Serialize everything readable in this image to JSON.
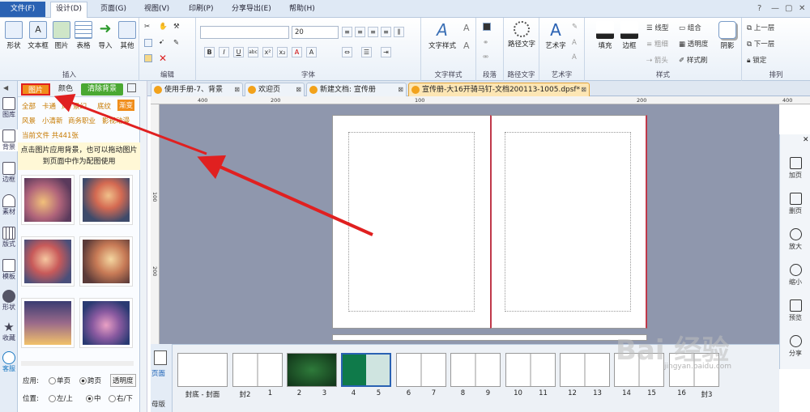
{
  "menu": {
    "file": "文件(F)",
    "items": [
      "设计(D)",
      "页面(G)",
      "视图(V)",
      "印刷(P)",
      "分享导出(E)",
      "帮助(H)"
    ],
    "active_index": 0,
    "window_controls": [
      "?",
      "—",
      "▢",
      "✕"
    ]
  },
  "ribbon": {
    "insert": {
      "label": "插入",
      "buttons": [
        "形状",
        "文本框",
        "图片",
        "表格",
        "导入",
        "其他"
      ]
    },
    "edit": {
      "label": "编辑"
    },
    "font": {
      "label": "字体",
      "font_size": "20",
      "formats": [
        "B",
        "I",
        "U",
        "abc",
        "x²",
        "x₂",
        "A",
        "A"
      ]
    },
    "paragraph": {
      "label": "段落"
    },
    "text_style": {
      "label": "文字样式",
      "button": "文字样式"
    },
    "path_text": {
      "label": "路径文字",
      "button": "路径文字"
    },
    "art_text": {
      "label": "艺术字",
      "button": "艺术字"
    },
    "style": {
      "label": "样式",
      "fill": "填充",
      "border": "边框",
      "line_type": "线型",
      "thickness": "粗细",
      "arrow": "箭头",
      "combine": "组合",
      "transparency": "透明度",
      "brush": "样式刷",
      "shadow": "阴影"
    },
    "arrange": {
      "label": "排列",
      "up": "上一层",
      "down": "下一层",
      "lock": "锁定"
    }
  },
  "leftbar": [
    {
      "label": "图库",
      "icon": "gallery-icon"
    },
    {
      "label": "背景",
      "icon": "background-icon"
    },
    {
      "label": "边框",
      "icon": "frame-icon"
    },
    {
      "label": "素材",
      "icon": "material-icon"
    },
    {
      "label": "版式",
      "icon": "layout-icon"
    },
    {
      "label": "模板",
      "icon": "template-icon"
    },
    {
      "label": "形状",
      "icon": "shape-icon"
    },
    {
      "label": "收藏",
      "icon": "star-icon"
    },
    {
      "label": "客服",
      "icon": "service-icon"
    }
  ],
  "panel": {
    "tabs": [
      "图片",
      "颜色"
    ],
    "clear_bg": "清除背景",
    "cats_row1": [
      "全部",
      "卡通",
      "风",
      "景幻",
      "底纹"
    ],
    "selected_cat": "渐变",
    "cats_row2": [
      "风景",
      "小清新",
      "商务职业",
      "影视动漫"
    ],
    "current_file": "当前文件  共441张",
    "tip": "点击图片应用背景，也可以拖动图片到页面中作为配图使用",
    "apply_label": "应用:",
    "apply_opts": [
      "单页",
      "跨页"
    ],
    "transparency_btn": "透明度",
    "pos_label": "位置:",
    "pos_opts": [
      "左/上",
      "中",
      "右/下"
    ]
  },
  "doctabs": [
    {
      "title": "使用手册-7、背景"
    },
    {
      "title": "欢迎页"
    },
    {
      "title": "新建文档: 宣传册"
    },
    {
      "title": "宣传册-大16开骑马钉-文档200113-1005.dpsf*"
    }
  ],
  "ruler": {
    "h": [
      "400",
      "200",
      "100",
      "200",
      "400"
    ],
    "v": [
      "100",
      "200"
    ]
  },
  "rightpanel": [
    {
      "label": "加页",
      "icon": "add-page-icon"
    },
    {
      "label": "删页",
      "icon": "delete-page-icon"
    },
    {
      "label": "放大",
      "icon": "zoom-in-icon"
    },
    {
      "label": "缩小",
      "icon": "zoom-out-icon"
    },
    {
      "label": "预览",
      "icon": "preview-icon"
    },
    {
      "label": "分享",
      "icon": "share-icon"
    }
  ],
  "strip": {
    "side": [
      "页面",
      "母版"
    ],
    "pages": [
      "封底 - 封面",
      "封2",
      "1",
      "2",
      "3",
      "4",
      "5",
      "6",
      "7",
      "8",
      "9",
      "10",
      "11",
      "12",
      "13",
      "14",
      "15",
      "16",
      "封3"
    ]
  },
  "watermark": {
    "logo": "Bai 经验",
    "sub": "jingyan.baidu.com"
  },
  "colors": {
    "accent": "#2a62b3",
    "highlight_red": "#e02020",
    "canvas": "#8f97ad",
    "tab_active": "#fde6b4"
  }
}
